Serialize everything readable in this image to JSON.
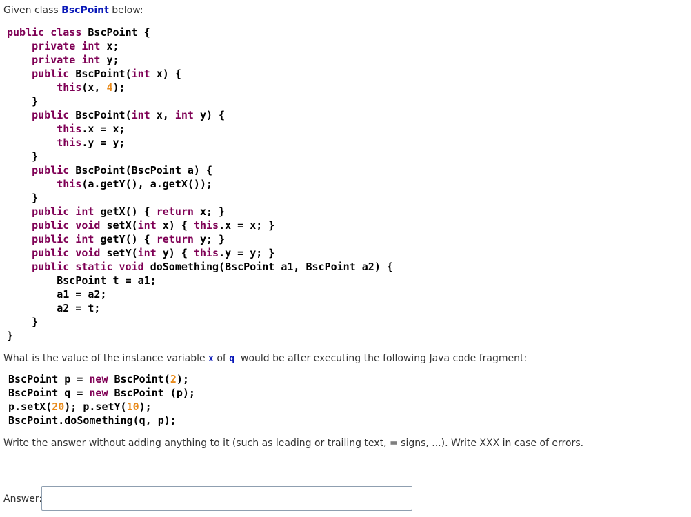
{
  "intro": {
    "prefix": "Given class",
    "class_name": "BscPoint",
    "suffix": "below:"
  },
  "class_code": [
    [
      [
        "kw",
        "public class "
      ],
      [
        "pl",
        "BscPoint {"
      ]
    ],
    [
      [
        "pl",
        "    "
      ],
      [
        "kw",
        "private int "
      ],
      [
        "pl",
        "x;"
      ]
    ],
    [
      [
        "pl",
        "    "
      ],
      [
        "kw",
        "private int "
      ],
      [
        "pl",
        "y;"
      ]
    ],
    [
      [
        "pl",
        "    "
      ],
      [
        "kw",
        "public "
      ],
      [
        "pl",
        "BscPoint("
      ],
      [
        "kw",
        "int "
      ],
      [
        "pl",
        "x) {"
      ]
    ],
    [
      [
        "pl",
        "        "
      ],
      [
        "kw",
        "this"
      ],
      [
        "pl",
        "(x, "
      ],
      [
        "num",
        "4"
      ],
      [
        "pl",
        ");"
      ]
    ],
    [
      [
        "pl",
        "    }"
      ]
    ],
    [
      [
        "pl",
        "    "
      ],
      [
        "kw",
        "public "
      ],
      [
        "pl",
        "BscPoint("
      ],
      [
        "kw",
        "int "
      ],
      [
        "pl",
        "x, "
      ],
      [
        "kw",
        "int "
      ],
      [
        "pl",
        "y) {"
      ]
    ],
    [
      [
        "pl",
        "        "
      ],
      [
        "kw",
        "this"
      ],
      [
        "pl",
        ".x = x;"
      ]
    ],
    [
      [
        "pl",
        "        "
      ],
      [
        "kw",
        "this"
      ],
      [
        "pl",
        ".y = y;"
      ]
    ],
    [
      [
        "pl",
        "    }"
      ]
    ],
    [
      [
        "pl",
        "    "
      ],
      [
        "kw",
        "public "
      ],
      [
        "pl",
        "BscPoint(BscPoint a) {"
      ]
    ],
    [
      [
        "pl",
        "        "
      ],
      [
        "kw",
        "this"
      ],
      [
        "pl",
        "(a.getY(), a.getX());"
      ]
    ],
    [
      [
        "pl",
        "    }"
      ]
    ],
    [
      [
        "pl",
        "    "
      ],
      [
        "kw",
        "public int "
      ],
      [
        "pl",
        "getX() { "
      ],
      [
        "kw",
        "return "
      ],
      [
        "pl",
        "x; }"
      ]
    ],
    [
      [
        "pl",
        "    "
      ],
      [
        "kw",
        "public void "
      ],
      [
        "pl",
        "setX("
      ],
      [
        "kw",
        "int "
      ],
      [
        "pl",
        "x) { "
      ],
      [
        "kw",
        "this"
      ],
      [
        "pl",
        ".x = x; }"
      ]
    ],
    [
      [
        "pl",
        "    "
      ],
      [
        "kw",
        "public int "
      ],
      [
        "pl",
        "getY() { "
      ],
      [
        "kw",
        "return "
      ],
      [
        "pl",
        "y; }"
      ]
    ],
    [
      [
        "pl",
        "    "
      ],
      [
        "kw",
        "public void "
      ],
      [
        "pl",
        "setY("
      ],
      [
        "kw",
        "int "
      ],
      [
        "pl",
        "y) { "
      ],
      [
        "kw",
        "this"
      ],
      [
        "pl",
        ".y = y; }"
      ]
    ],
    [
      [
        "pl",
        "    "
      ],
      [
        "kw",
        "public static void "
      ],
      [
        "pl",
        "doSomething(BscPoint a1, BscPoint a2) {"
      ]
    ],
    [
      [
        "pl",
        "        BscPoint t = a1;"
      ]
    ],
    [
      [
        "pl",
        "        a1 = a2;"
      ]
    ],
    [
      [
        "pl",
        "        a2 = t;"
      ]
    ],
    [
      [
        "pl",
        "    }"
      ]
    ],
    [
      [
        "pl",
        "}"
      ]
    ]
  ],
  "question": {
    "p1": "What is the value of the instance variable",
    "var": "x",
    "p2": "of",
    "obj": "q",
    "p3": "would be after executing the following Java code fragment:"
  },
  "fragment_code": [
    [
      [
        "pl",
        "BscPoint p = "
      ],
      [
        "kw",
        "new "
      ],
      [
        "pl",
        "BscPoint("
      ],
      [
        "num",
        "2"
      ],
      [
        "pl",
        ");"
      ]
    ],
    [
      [
        "pl",
        "BscPoint q = "
      ],
      [
        "kw",
        "new "
      ],
      [
        "pl",
        "BscPoint (p);"
      ]
    ],
    [
      [
        "pl",
        "p.setX("
      ],
      [
        "num",
        "20"
      ],
      [
        "pl",
        "); p.setY("
      ],
      [
        "num",
        "10"
      ],
      [
        "pl",
        ");"
      ]
    ],
    [
      [
        "pl",
        "BscPoint.doSomething(q, p);"
      ]
    ]
  ],
  "instructions": "Write the answer without adding anything to it (such as leading or trailing text, = signs, ...). Write XXX in case of errors.",
  "answer": {
    "label": "Answer:",
    "value": ""
  }
}
